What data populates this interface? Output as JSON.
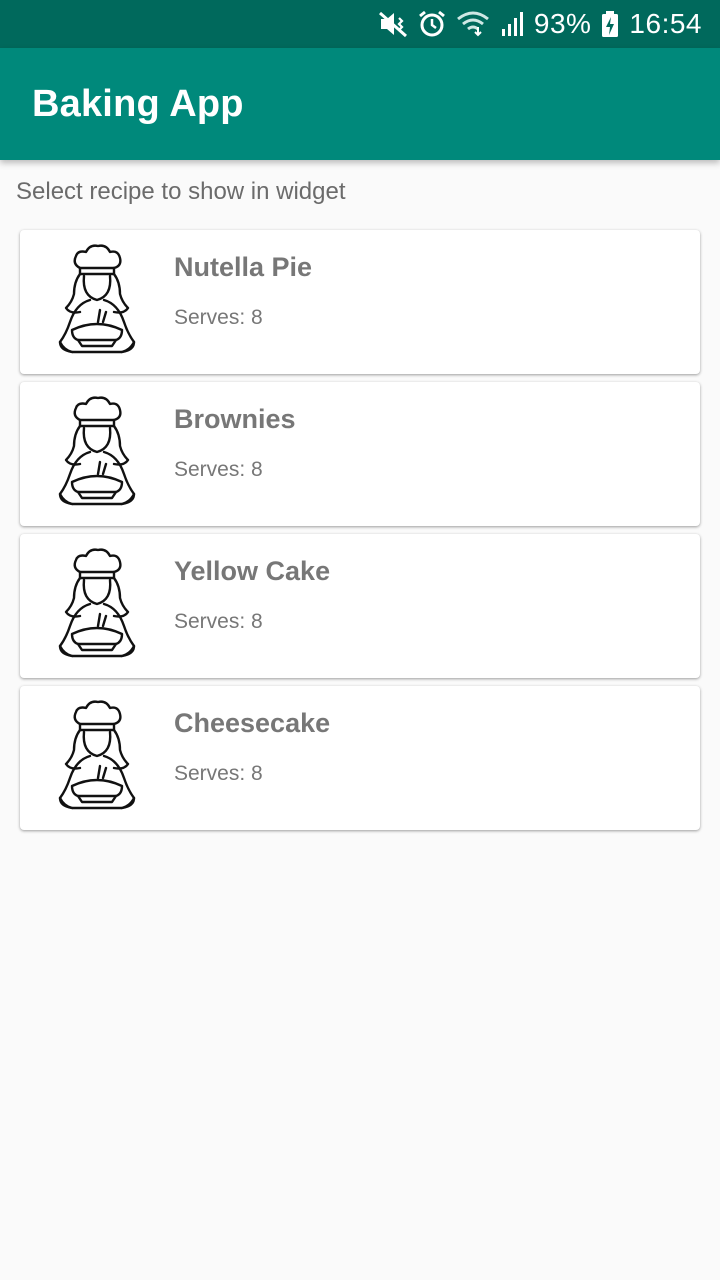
{
  "status_bar": {
    "battery_percent": "93%",
    "time": "16:54",
    "icons": [
      "mute-vibrate-icon",
      "alarm-icon",
      "wifi-icon",
      "signal-icon",
      "battery-charging-icon"
    ]
  },
  "toolbar": {
    "title": "Baking App"
  },
  "main": {
    "instruction": "Select recipe to show in widget",
    "recipes": [
      {
        "name": "Nutella Pie",
        "serves": "Serves: 8",
        "icon": "chef-baker-icon"
      },
      {
        "name": "Brownies",
        "serves": "Serves: 8",
        "icon": "chef-baker-icon"
      },
      {
        "name": "Yellow Cake",
        "serves": "Serves: 8",
        "icon": "chef-baker-icon"
      },
      {
        "name": "Cheesecake",
        "serves": "Serves: 8",
        "icon": "chef-baker-icon"
      }
    ]
  },
  "colors": {
    "status_bar": "#00695c",
    "toolbar": "#00897b",
    "background": "#fafafa",
    "card_text": "#777777"
  }
}
